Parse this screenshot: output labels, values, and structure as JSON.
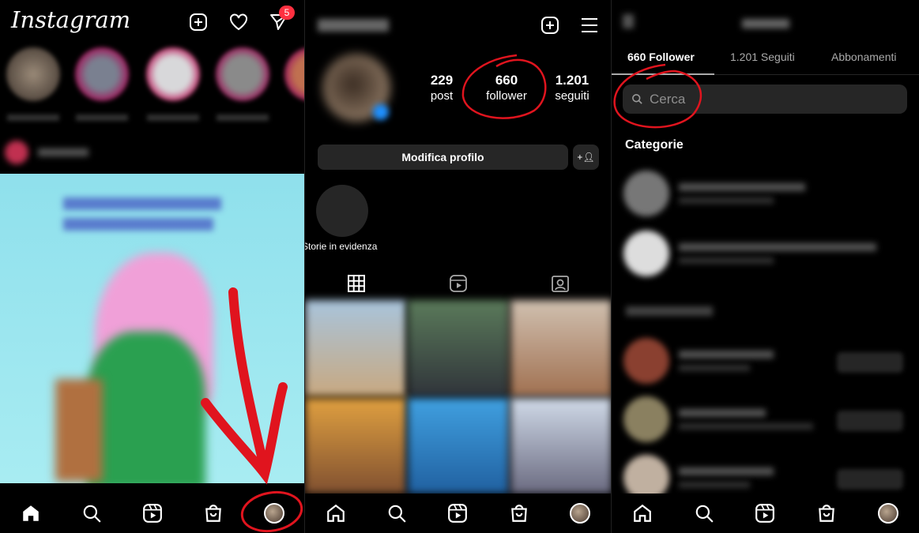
{
  "feed": {
    "logo": "Instagram",
    "notification_count": "5",
    "accent": "#ff3040",
    "annotation_color": "#e0141e"
  },
  "profile": {
    "stats": [
      {
        "value": "229",
        "label": "post"
      },
      {
        "value": "660",
        "label": "follower"
      },
      {
        "value": "1.201",
        "label": "seguiti"
      }
    ],
    "edit_button": "Modifica profilo",
    "highlight_label": "Storie in evidenza"
  },
  "followers": {
    "tabs": [
      "660 Follower",
      "1.201 Seguiti",
      "Abbonamenti"
    ],
    "search_placeholder": "Cerca",
    "categories_heading": "Categorie"
  },
  "nav_icons": [
    "home-icon",
    "search-icon",
    "reels-icon",
    "shop-icon",
    "profile-avatar"
  ]
}
